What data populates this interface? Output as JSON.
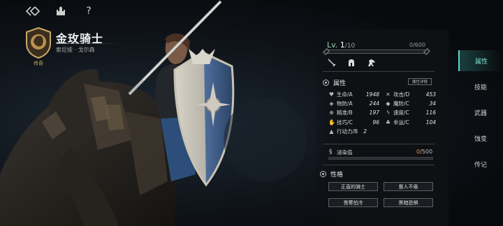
{
  "topbar": {
    "back_icon": "double-chevron-back-icon",
    "home_icon": "castle-icon",
    "help_label": "?"
  },
  "character": {
    "name": "金玫骑士",
    "subtitle": "索尼娅 · 戈尔森",
    "rarity": "传奇"
  },
  "level": {
    "prefix": "Lv.",
    "current": "1",
    "max": "/10",
    "exp_text": "0/600",
    "exp_fraction": 0.0
  },
  "class_icons": [
    "sword-icon",
    "helmet-icon",
    "horse-icon"
  ],
  "attributes": {
    "title": "属性",
    "detail_button": "属性详情",
    "stats": [
      {
        "icon": "heart-icon",
        "label": "生命/A",
        "value": "1948"
      },
      {
        "icon": "crossed-swords-icon",
        "label": "攻击/D",
        "value": "453"
      },
      {
        "icon": "shield-icon",
        "label": "物防/A",
        "value": "244"
      },
      {
        "icon": "magic-shield-icon",
        "label": "魔防/C",
        "value": "34"
      },
      {
        "icon": "crosshair-icon",
        "label": "精准/B",
        "value": "197"
      },
      {
        "icon": "lightning-icon",
        "label": "速度/C",
        "value": "116"
      },
      {
        "icon": "skill-icon",
        "label": "技巧/C",
        "value": "96"
      },
      {
        "icon": "clover-icon",
        "label": "幸运/C",
        "value": "104"
      },
      {
        "icon": "boot-icon",
        "label": "行动力/B",
        "value": "2"
      }
    ]
  },
  "infection": {
    "label": "浸染值",
    "current": "0",
    "max": "/500",
    "fraction": 0.0
  },
  "traits": {
    "title": "性格",
    "items": [
      "正直的骑士",
      "督人不倦",
      "畏寒怕冷",
      "黑暗恐惧"
    ]
  },
  "nav": {
    "items": [
      "属性",
      "技能",
      "武器",
      "蚀变",
      "传记"
    ],
    "active_index": 0
  },
  "colors": {
    "accent": "#5fd6c8",
    "level": "#9fd9b5",
    "infection_current": "#f08a3c"
  }
}
